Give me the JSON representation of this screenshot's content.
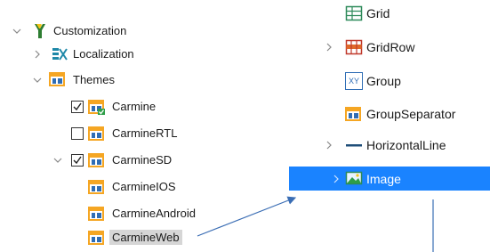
{
  "left_tree": {
    "items": [
      {
        "label": "Customization",
        "icon": "customization-icon",
        "expanded": true
      },
      {
        "label": "Localization",
        "icon": "localization-icon",
        "expanded": false
      },
      {
        "label": "Themes",
        "icon": "theme-folder-icon",
        "expanded": true
      },
      {
        "label": "Carmine",
        "icon": "theme-icon",
        "checked": true
      },
      {
        "label": "CarmineRTL",
        "icon": "theme-icon",
        "checked": false
      },
      {
        "label": "CarmineSD",
        "icon": "theme-icon",
        "checked": true,
        "expanded": true
      },
      {
        "label": "CarmineIOS",
        "icon": "theme-icon"
      },
      {
        "label": "CarmineAndroid",
        "icon": "theme-icon"
      },
      {
        "label": "CarmineWeb",
        "icon": "theme-icon",
        "selected": true
      }
    ]
  },
  "right_tree": {
    "items": [
      {
        "label": "Grid",
        "icon": "grid-icon"
      },
      {
        "label": "GridRow",
        "icon": "grid-row-icon",
        "expandable": true
      },
      {
        "label": "Group",
        "icon": "group-xy-icon",
        "icon_text": "XY"
      },
      {
        "label": "GroupSeparator",
        "icon": "group-separator-icon"
      },
      {
        "label": "HorizontalLine",
        "icon": "horizontal-line-icon",
        "expandable": true
      },
      {
        "label": "Image",
        "icon": "image-icon",
        "expandable": true,
        "selected": true
      }
    ]
  },
  "colors": {
    "selection_blue": "#1a83ff",
    "selection_gray": "#d6d6d6",
    "theme_orange": "#f5a623",
    "theme_blue": "#2f6db5",
    "arrow_blue": "#3a6db4"
  }
}
